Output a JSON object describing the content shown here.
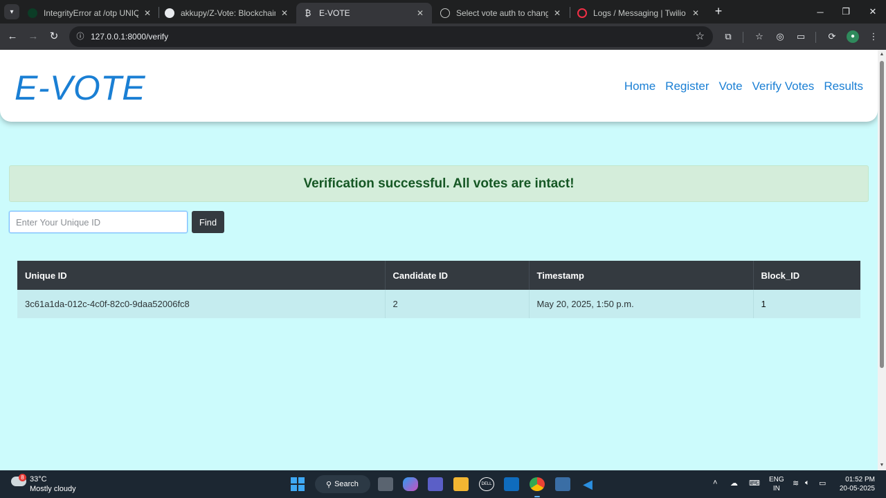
{
  "browser": {
    "tabs": [
      {
        "title": "IntegrityError at /otp UNIQUE constraint failed",
        "active": false
      },
      {
        "title": "akkupy/Z-Vote: Blockchain Based E-Voting",
        "active": false
      },
      {
        "title": "E-VOTE",
        "active": true
      },
      {
        "title": "Select vote auth to change | Django site admin",
        "active": false
      },
      {
        "title": "Logs / Messaging | Twilio Console",
        "active": false
      }
    ],
    "url": "127.0.0.1:8000/verify"
  },
  "site": {
    "logo": "E-VOTE",
    "nav": [
      "Home",
      "Register",
      "Vote",
      "Verify Votes",
      "Results"
    ]
  },
  "alert": {
    "message": "Verification successful. All votes are intact!",
    "color": "#155724"
  },
  "search": {
    "placeholder": "Enter Your Unique ID",
    "button_label": "Find"
  },
  "table": {
    "headers": [
      "Unique ID",
      "Candidate ID",
      "Timestamp",
      "Block_ID"
    ],
    "rows": [
      [
        "3c61a1da-012c-4c0f-82c0-9daa52006fc8",
        "2",
        "May 20, 2025, 1:50 p.m.",
        "1"
      ]
    ]
  },
  "taskbar": {
    "weather_badge": "8",
    "temperature": "33°C",
    "weather": "Mostly cloudy",
    "search_label": "Search",
    "language": "ENG",
    "region": "IN",
    "time": "01:52 PM",
    "date": "20-05-2025"
  },
  "colors": {
    "page_bg": "#ccfbfc",
    "brand": "#1a7fd4",
    "table_header": "#343a40",
    "row_bg": "#c5ecef"
  }
}
